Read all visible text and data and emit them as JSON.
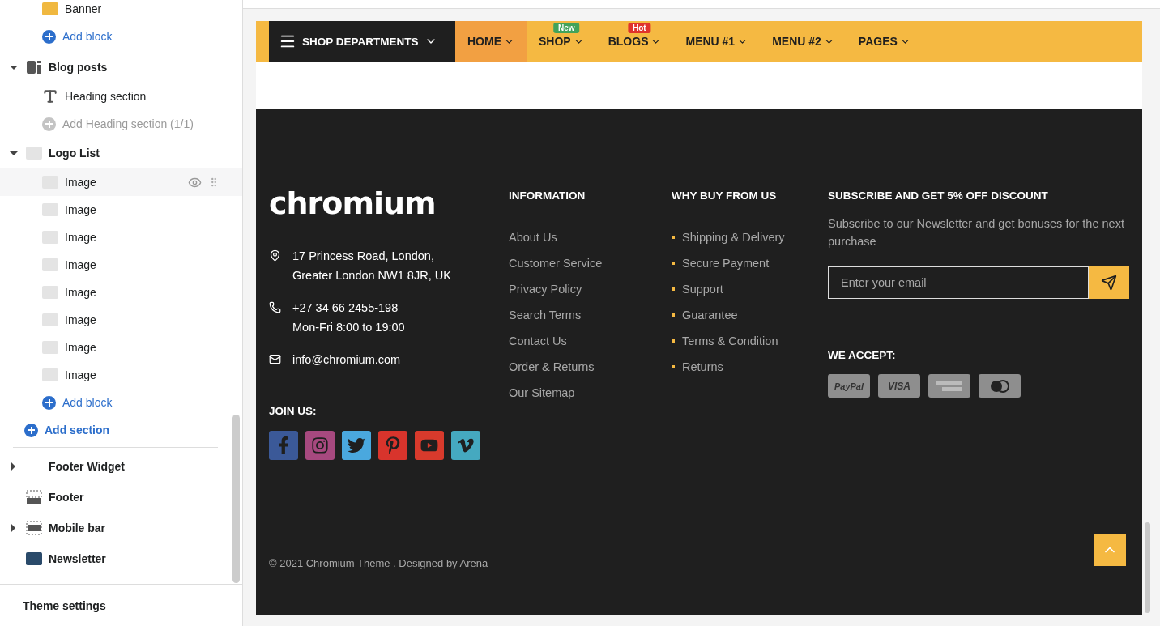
{
  "sidebar": {
    "continued_blocks": [
      {
        "kind": "banner",
        "label": "Banner"
      },
      {
        "kind": "add",
        "label": "Add block",
        "disabled": false
      }
    ],
    "sections": [
      {
        "label": "Blog posts",
        "kind": "blog",
        "expanded": true,
        "children": [
          {
            "kind": "heading",
            "label": "Heading section"
          },
          {
            "kind": "add",
            "label": "Add Heading section (1/1)",
            "disabled": true
          }
        ]
      },
      {
        "label": "Logo List",
        "kind": "logo",
        "expanded": true,
        "children": [
          {
            "kind": "logo",
            "label": "Image",
            "hovered": true
          },
          {
            "kind": "logo",
            "label": "Image",
            "hovered": false
          },
          {
            "kind": "logo",
            "label": "Image",
            "hovered": false
          },
          {
            "kind": "logo",
            "label": "Image",
            "hovered": false
          },
          {
            "kind": "logo",
            "label": "Image",
            "hovered": false
          },
          {
            "kind": "logo",
            "label": "Image",
            "hovered": false
          },
          {
            "kind": "logo",
            "label": "Image",
            "hovered": false
          },
          {
            "kind": "logo",
            "label": "Image",
            "hovered": false
          },
          {
            "kind": "add",
            "label": "Add block",
            "disabled": false
          }
        ]
      }
    ],
    "add_section": "Add section",
    "footer_sections": [
      {
        "label": "Footer Widget",
        "kind": "plain",
        "expanded": false
      },
      {
        "label": "Footer",
        "kind": "footer"
      },
      {
        "label": "Mobile bar",
        "kind": "bar",
        "expanded": false
      },
      {
        "label": "Newsletter",
        "kind": "photo"
      }
    ],
    "theme_settings": "Theme settings"
  },
  "preview": {
    "nav": {
      "departments": "SHOP DEPARTMENTS",
      "items": [
        {
          "label": "HOME",
          "selected": true
        },
        {
          "label": "SHOP",
          "selected": false,
          "badge": {
            "text": "New",
            "color": "#43a35a"
          }
        },
        {
          "label": "BLOGS",
          "selected": false,
          "badge": {
            "text": "Hot",
            "color": "#e0332b"
          }
        },
        {
          "label": "MENU #1",
          "selected": false
        },
        {
          "label": "MENU #2",
          "selected": false
        },
        {
          "label": "PAGES",
          "selected": false
        }
      ]
    },
    "footer": {
      "logo": "chromium",
      "contacts": [
        {
          "kind": "location",
          "lines": [
            "17 Princess Road, London,",
            "Greater London NW1 8JR, UK"
          ]
        },
        {
          "kind": "phone",
          "lines": [
            "+27 34 66 2455-198",
            "Mon-Fri 8:00 to 19:00"
          ]
        },
        {
          "kind": "email",
          "lines": [
            "info@chromium.com"
          ]
        }
      ],
      "join_title": "JOIN US:",
      "socials": [
        {
          "kind": "facebook",
          "color": "#3b5998"
        },
        {
          "kind": "instagram",
          "color": "#a7497f"
        },
        {
          "kind": "twitter",
          "color": "#4aa8de"
        },
        {
          "kind": "pinterest",
          "color": "#d8342c"
        },
        {
          "kind": "youtube",
          "color": "#d83a2c"
        },
        {
          "kind": "vimeo",
          "color": "#45a9c0"
        }
      ],
      "columns": [
        {
          "title": "INFORMATION",
          "bullets": false,
          "links": [
            "About Us",
            "Customer Service",
            "Privacy Policy",
            "Search Terms",
            "Contact Us",
            "Order & Returns",
            "Our Sitemap"
          ]
        },
        {
          "title": "WHY BUY FROM US",
          "bullets": true,
          "links": [
            "Shipping & Delivery",
            "Secure Payment",
            "Support",
            "Guarantee",
            "Terms & Condition",
            "Returns"
          ]
        }
      ],
      "subscribe": {
        "title": "SUBSCRIBE AND GET 5% OFF DISCOUNT",
        "text": "Subscribe to our Newsletter and get bonuses for the next purchase",
        "placeholder": "Enter your email"
      },
      "accept_title": "WE ACCEPT:",
      "cards": [
        {
          "kind": "paypal",
          "text": "PayPal"
        },
        {
          "kind": "visa",
          "text": "VISA"
        },
        {
          "kind": "amex"
        },
        {
          "kind": "mastercard"
        }
      ],
      "copyright": "© 2021 Chromium Theme . Designed by Arena"
    }
  }
}
